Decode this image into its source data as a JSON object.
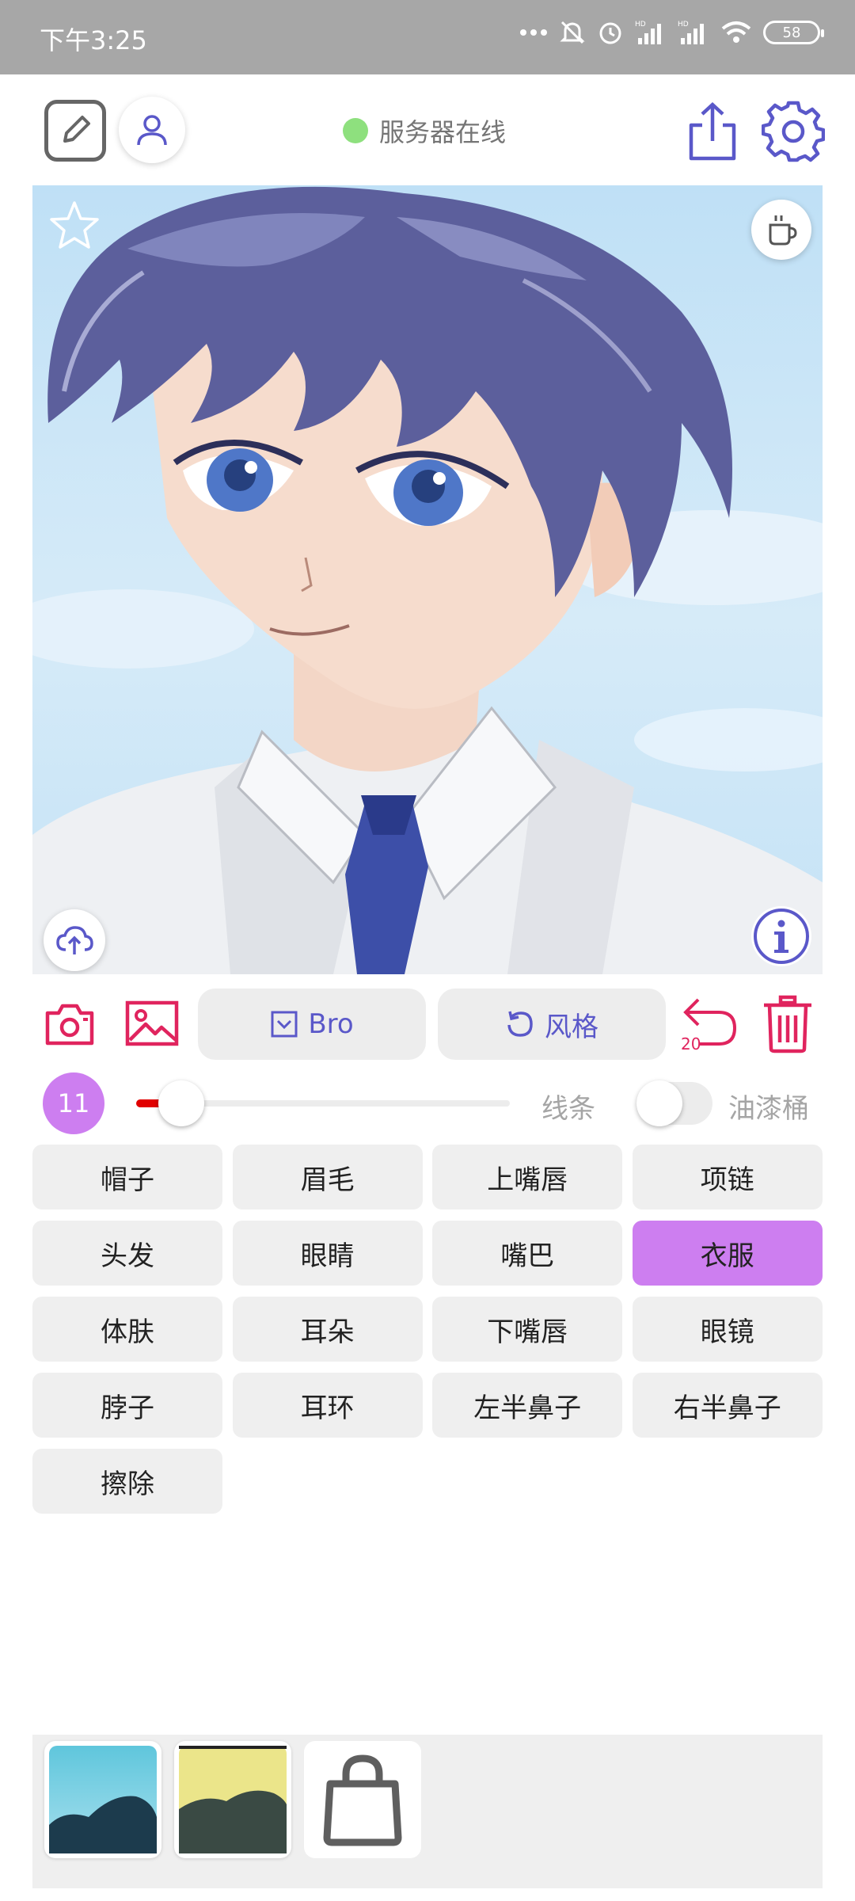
{
  "status_bar": {
    "time": "下午3:25",
    "battery": "58",
    "icons": [
      "more-icon",
      "mute-icon",
      "alarm-icon",
      "signal-hd-icon",
      "signal-hd-icon",
      "wifi-icon",
      "battery-icon"
    ]
  },
  "header": {
    "server_status": "服务器在线",
    "server_status_color": "#8ee07e"
  },
  "toolbar": {
    "bro_label": "Bro",
    "style_label": "风格",
    "undo_count": "20"
  },
  "brush": {
    "size": "11",
    "slider_fraction": 0.12,
    "line_label": "线条",
    "bucket_label": "油漆桶",
    "bucket_enabled": false
  },
  "labels": [
    {
      "text": "帽子",
      "active": false
    },
    {
      "text": "眉毛",
      "active": false
    },
    {
      "text": "上嘴唇",
      "active": false
    },
    {
      "text": "项链",
      "active": false
    },
    {
      "text": "头发",
      "active": false
    },
    {
      "text": "眼睛",
      "active": false
    },
    {
      "text": "嘴巴",
      "active": false
    },
    {
      "text": "衣服",
      "active": true
    },
    {
      "text": "体肤",
      "active": false
    },
    {
      "text": "耳朵",
      "active": false
    },
    {
      "text": "下嘴唇",
      "active": false
    },
    {
      "text": "眼镜",
      "active": false
    },
    {
      "text": "脖子",
      "active": false
    },
    {
      "text": "耳环",
      "active": false
    },
    {
      "text": "左半鼻子",
      "active": false
    },
    {
      "text": "右半鼻子",
      "active": false
    },
    {
      "text": "擦除",
      "active": false
    }
  ],
  "colors": {
    "accent_purple": "#5a58c9",
    "accent_pink": "#e0245e",
    "active_label": "#cd7ef0",
    "slider_fill": "#e10000"
  }
}
